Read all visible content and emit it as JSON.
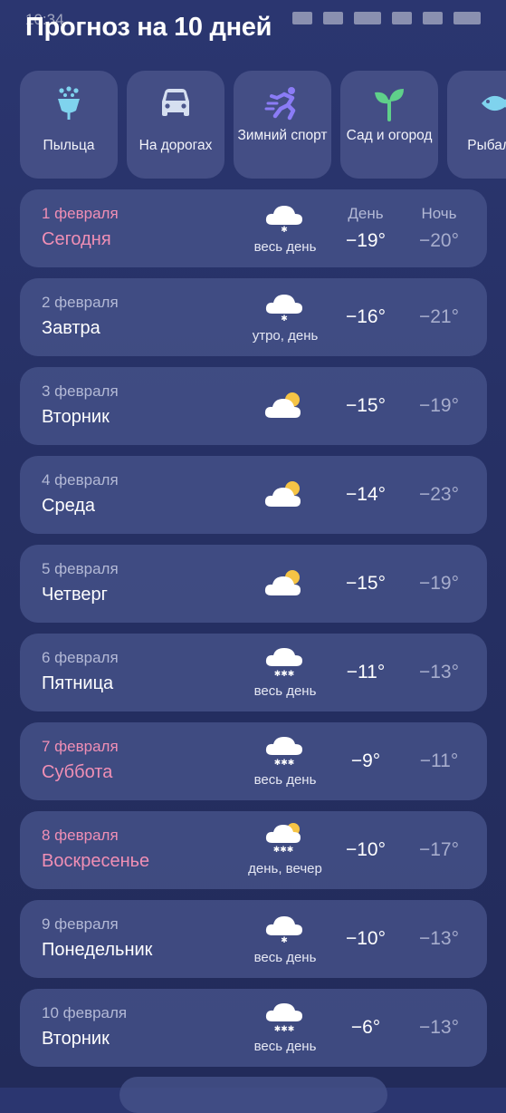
{
  "status_bar": {
    "time": "10:34"
  },
  "header": {
    "title": "Прогноз на 10 дней"
  },
  "categories": [
    {
      "label": "Пыльца",
      "icon": "pollen-flower-icon",
      "color": "#7fd3ee"
    },
    {
      "label": "На дорогах",
      "icon": "car-icon",
      "color": "#d6dff0"
    },
    {
      "label": "Зимний спорт",
      "icon": "skier-icon",
      "color": "#8b7cf6"
    },
    {
      "label": "Сад и огород",
      "icon": "sprout-icon",
      "color": "#5fd08a"
    },
    {
      "label": "Рыбалка",
      "icon": "fish-icon",
      "color": "#7fd3ee"
    }
  ],
  "columns": {
    "day": "День",
    "night": "Ночь"
  },
  "days": [
    {
      "date": "1 февраля",
      "name": "Сегодня",
      "icon": "snow-light-icon",
      "note": "весь день",
      "day": "−19°",
      "night": "−20°",
      "highlight": true
    },
    {
      "date": "2 февраля",
      "name": "Завтра",
      "icon": "snow-light-icon",
      "note": "утро, день",
      "day": "−16°",
      "night": "−21°",
      "highlight": false
    },
    {
      "date": "3 февраля",
      "name": "Вторник",
      "icon": "partly-cloudy-icon",
      "note": "",
      "day": "−15°",
      "night": "−19°",
      "highlight": false
    },
    {
      "date": "4 февраля",
      "name": "Среда",
      "icon": "partly-cloudy-icon",
      "note": "",
      "day": "−14°",
      "night": "−23°",
      "highlight": false
    },
    {
      "date": "5 февраля",
      "name": "Четверг",
      "icon": "partly-cloudy-icon",
      "note": "",
      "day": "−15°",
      "night": "−19°",
      "highlight": false
    },
    {
      "date": "6 февраля",
      "name": "Пятница",
      "icon": "snow-heavy-icon",
      "note": "весь день",
      "day": "−11°",
      "night": "−13°",
      "highlight": false
    },
    {
      "date": "7 февраля",
      "name": "Суббота",
      "icon": "snow-heavy-icon",
      "note": "весь день",
      "day": "−9°",
      "night": "−11°",
      "highlight": true
    },
    {
      "date": "8 февраля",
      "name": "Воскресенье",
      "icon": "sun-cloud-snow-icon",
      "note": "день, вечер",
      "day": "−10°",
      "night": "−17°",
      "highlight": true
    },
    {
      "date": "9 февраля",
      "name": "Понедельник",
      "icon": "snow-light-icon",
      "note": "весь день",
      "day": "−10°",
      "night": "−13°",
      "highlight": false
    },
    {
      "date": "10 февраля",
      "name": "Вторник",
      "icon": "snow-heavy-icon",
      "note": "весь день",
      "day": "−6°",
      "night": "−13°",
      "highlight": false
    }
  ]
}
